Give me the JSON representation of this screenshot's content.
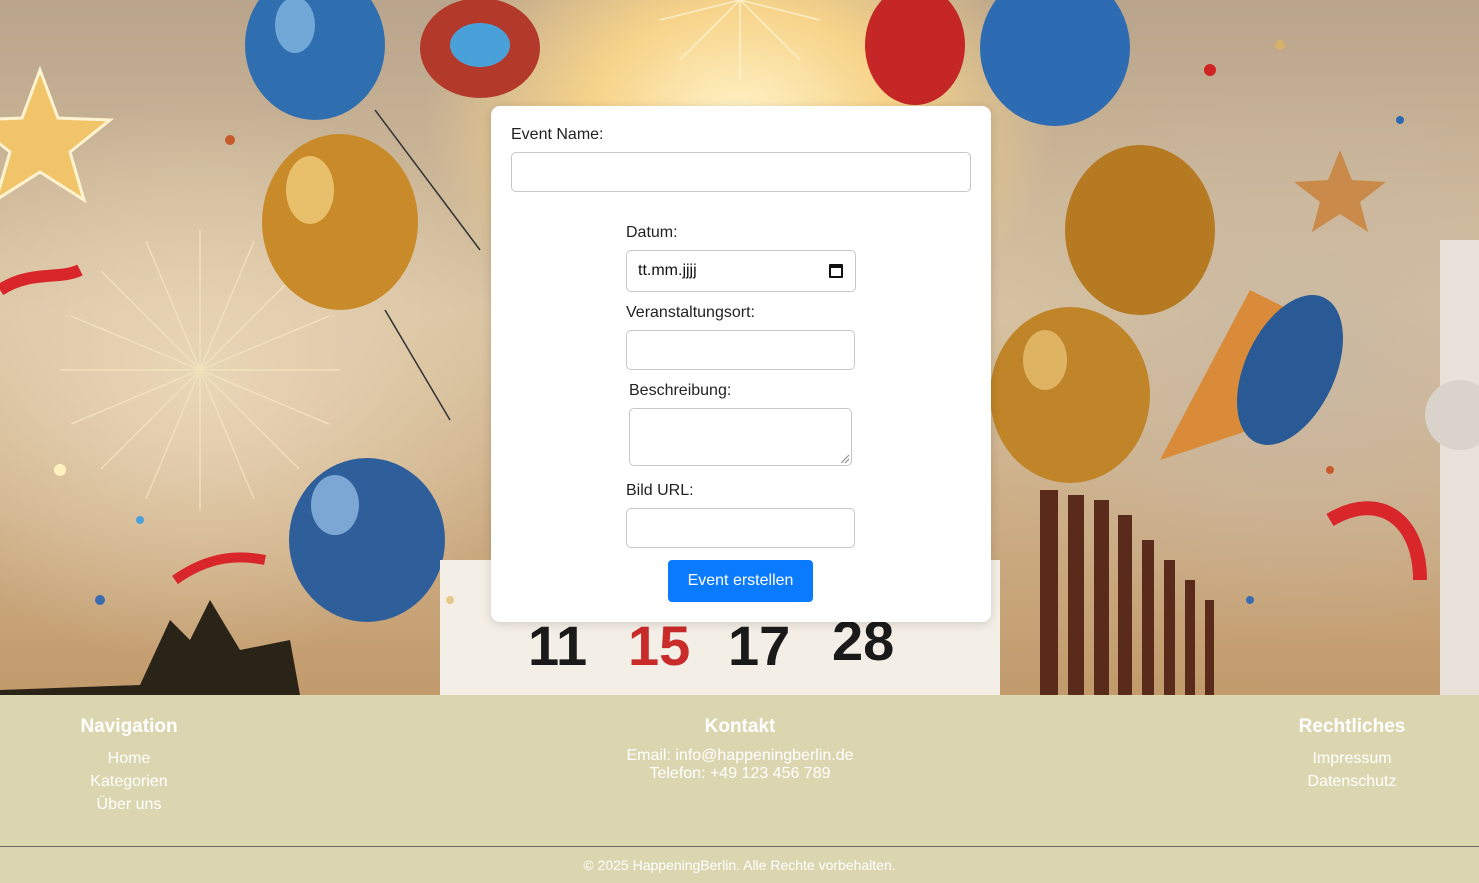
{
  "form": {
    "event_name_label": "Event Name:",
    "event_name_value": "",
    "date_label": "Datum:",
    "date_placeholder": "tt.mm.jjjj",
    "location_label": "Veranstaltungsort:",
    "location_value": "",
    "description_label": "Beschreibung:",
    "description_value": "",
    "image_url_label": "Bild URL:",
    "image_url_value": "",
    "submit_label": "Event erstellen"
  },
  "footer": {
    "navigation": {
      "title": "Navigation",
      "links": [
        "Home",
        "Kategorien",
        "Über uns"
      ]
    },
    "contact": {
      "title": "Kontakt",
      "email": "Email: info@happeningberlin.de",
      "phone": "Telefon: +49 123 456 789"
    },
    "legal": {
      "title": "Rechtliches",
      "links": [
        "Impressum",
        "Datenschutz"
      ]
    },
    "copyright": "© 2025 HappeningBerlin. Alle Rechte vorbehalten."
  },
  "colors": {
    "button": "#0a7bff",
    "footer_bg": "#dcd6b0",
    "card_bg": "#ffffff"
  },
  "icons": {
    "date_picker": "calendar-icon"
  }
}
